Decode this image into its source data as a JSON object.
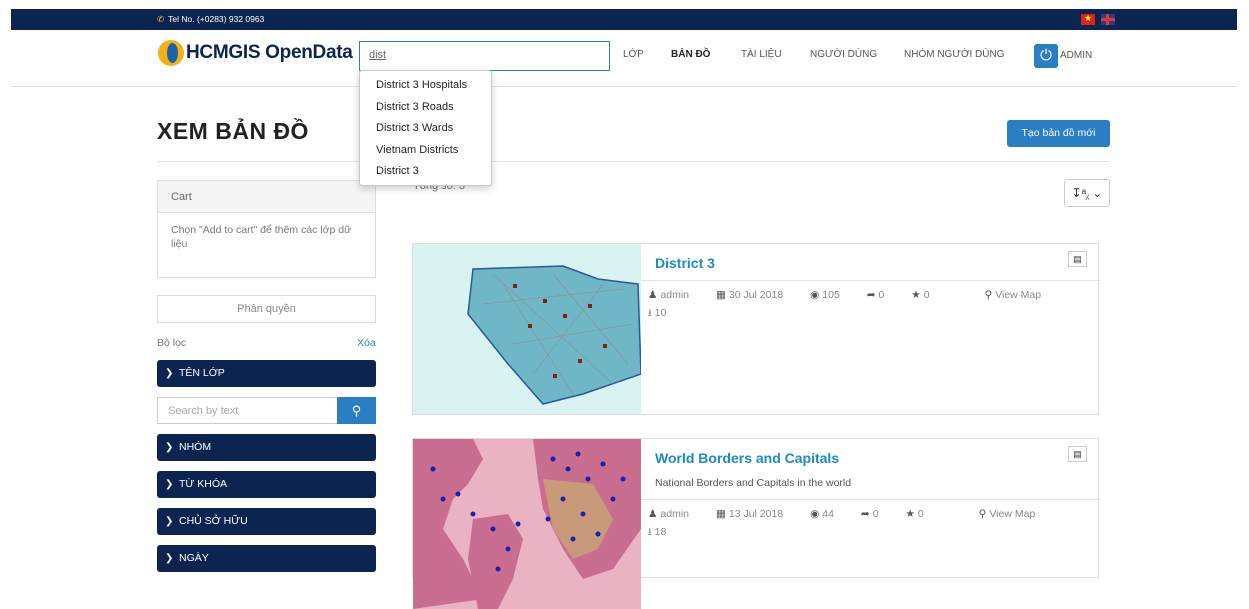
{
  "topbar": {
    "tel": "Tel No. (+0283) 932 0963"
  },
  "brand": {
    "name": "HCMGIS OpenData"
  },
  "search": {
    "value": "dist",
    "suggestions": [
      "District 3 Hospitals",
      "District 3 Roads",
      "District 3 Wards",
      "Vietnam Districts",
      "District 3"
    ]
  },
  "nav": {
    "layers": "LỚP",
    "maps": "BẢN ĐỒ",
    "documents": "TÀI LIỆU",
    "users": "NGƯỜI DÙNG",
    "groups": "NHÓM NGƯỜI DÙNG",
    "admin": "ADMIN"
  },
  "page": {
    "title": "XEM BẢN ĐỒ",
    "new_map": "Tạo bản đồ mới",
    "total": "Tổng số: 3"
  },
  "sidebar": {
    "cart_title": "Cart",
    "cart_body": "Chọn \"Add to cart\" để thêm các lớp dữ liệu",
    "permissions": "Phân quyền",
    "filter_label": "Bộ lọc",
    "clear": "Xóa",
    "filters": [
      "TÊN LỚP",
      "NHÓM",
      "TỪ KHÓA",
      "CHỦ SỞ HỮU",
      "NGÀY"
    ],
    "search_placeholder": "Search by text"
  },
  "maps": [
    {
      "title": "District 3",
      "description": "",
      "owner": "admin",
      "date": "30 Jul 2018",
      "views": "105",
      "shares": "0",
      "rating": "0",
      "view_map": "View Map",
      "downloads": "10"
    },
    {
      "title": "World Borders and Capitals",
      "description": "National Borders and Capitals in the world",
      "owner": "admin",
      "date": "13 Jul 2018",
      "views": "44",
      "shares": "0",
      "rating": "0",
      "view_map": "View Map",
      "downloads": "18"
    }
  ],
  "icons": {
    "phone": "phone-icon",
    "power": "power-icon",
    "search": "search-icon",
    "sort": "sort-alpha-icon",
    "cart": "cart-icon",
    "user": "user-icon",
    "calendar": "calendar-icon",
    "eye": "eye-icon",
    "share": "share-icon",
    "star": "star-icon",
    "marker": "map-marker-icon",
    "download": "download-icon",
    "chevron": "chevron-icon"
  }
}
